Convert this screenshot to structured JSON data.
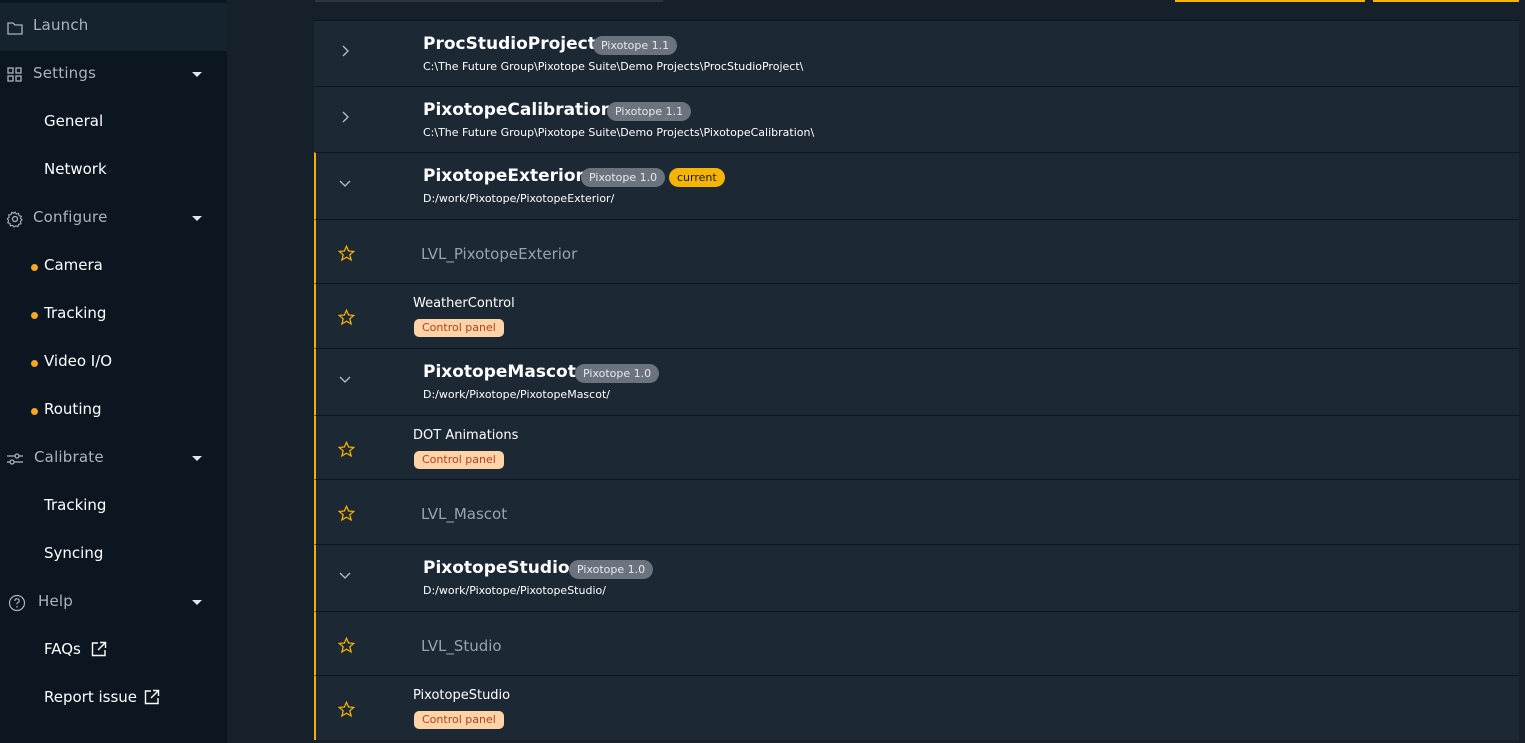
{
  "sidebar": {
    "launch": "Launch",
    "settings": "Settings",
    "settings_items": [
      "General",
      "Network"
    ],
    "configure": "Configure",
    "configure_items": [
      "Camera",
      "Tracking",
      "Video I/O",
      "Routing"
    ],
    "calibrate": "Calibrate",
    "calibrate_items": [
      "Tracking",
      "Syncing"
    ],
    "help": "Help",
    "help_items": [
      "FAQs",
      "Report issue"
    ]
  },
  "projects": [
    {
      "name": "ProcStudioProject",
      "version": "Pixotope 1.1",
      "path": "C:\\The Future Group\\Pixotope Suite\\Demo Projects\\ProcStudioProject\\"
    },
    {
      "name": "PixotopeCalibration",
      "version": "Pixotope 1.1",
      "path": "C:\\The Future Group\\Pixotope Suite\\Demo Projects\\PixotopeCalibration\\"
    },
    {
      "name": "PixotopeExterior",
      "version": "Pixotope 1.0",
      "current_label": "current",
      "path": "D:/work/Pixotope/PixotopeExterior/",
      "items": [
        {
          "label": "LVL_PixotopeExterior"
        },
        {
          "title": "WeatherControl",
          "badge": "Control panel"
        }
      ]
    },
    {
      "name": "PixotopeMascot",
      "version": "Pixotope 1.0",
      "path": "D:/work/Pixotope/PixotopeMascot/",
      "items": [
        {
          "title": "DOT Animations",
          "badge": "Control panel"
        },
        {
          "label": "LVL_Mascot"
        }
      ]
    },
    {
      "name": "PixotopeStudio",
      "version": "Pixotope 1.0",
      "path": "D:/work/Pixotope/PixotopeStudio/",
      "items": [
        {
          "label": "LVL_Studio"
        },
        {
          "title": "PixotopeStudio",
          "badge": "Control panel"
        }
      ]
    }
  ],
  "colors": {
    "accent": "#f5b400",
    "nav_dot": "#f6a623",
    "badge_bg": "#ffd3a8",
    "badge_text": "#b3431e"
  }
}
